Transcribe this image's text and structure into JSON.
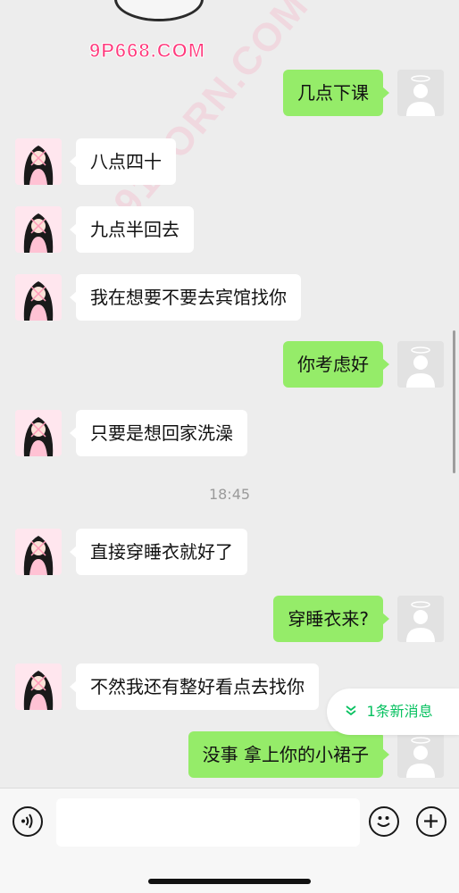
{
  "watermark": {
    "site": "9P668.COM",
    "diagonal": "91PORN.COM"
  },
  "messages": [
    {
      "side": "right",
      "text": "几点下课"
    },
    {
      "side": "left",
      "text": "八点四十"
    },
    {
      "side": "left",
      "text": "九点半回去"
    },
    {
      "side": "left",
      "text": "我在想要不要去宾馆找你"
    },
    {
      "side": "right",
      "text": "你考虑好"
    },
    {
      "side": "left",
      "text": "只要是想回家洗澡"
    },
    {
      "side": "left",
      "text": "直接穿睡衣就好了"
    },
    {
      "side": "right",
      "text": "穿睡衣来?"
    },
    {
      "side": "left",
      "text": "不然我还有整好看点去找你"
    },
    {
      "side": "right",
      "text": "没事 拿上你的小裙子"
    }
  ],
  "timestamp": "18:45",
  "new_messages": {
    "label": "1条新消息"
  },
  "input": {
    "value": ""
  },
  "icons": {
    "voice": "voice-icon",
    "emoji": "emoji-icon",
    "plus": "plus-icon",
    "chevron": "double-chevron-down-icon"
  },
  "colors": {
    "outgoing_bubble": "#95ec69",
    "incoming_bubble": "#ffffff",
    "accent": "#07c160",
    "background": "#ededed"
  }
}
